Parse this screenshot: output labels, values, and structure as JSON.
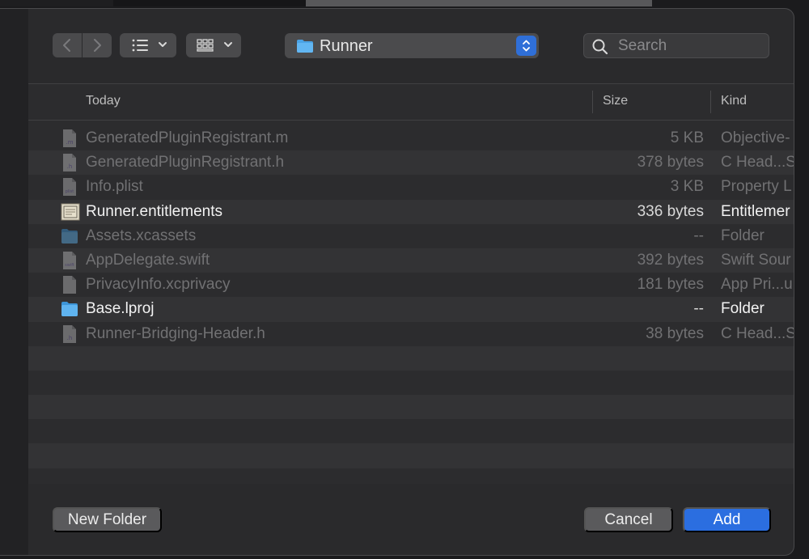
{
  "colors": {
    "accent": "#2b6ee0",
    "folder": "#4aa3e6",
    "panel": "#2a2a2c"
  },
  "toolbar": {
    "back_icon": "chevron-left-icon",
    "forward_icon": "chevron-right-icon",
    "list_view_icon": "list-view-icon",
    "grid_view_icon": "grid-view-icon"
  },
  "location": {
    "label": "Runner",
    "icon": "folder-icon"
  },
  "search": {
    "placeholder": "Search",
    "value": ""
  },
  "columns": {
    "name": "Today",
    "size": "Size",
    "kind": "Kind"
  },
  "files": [
    {
      "name": "GeneratedPluginRegistrant.m",
      "size": "5 KB",
      "kind": "Objective-",
      "icon": "objc-source-file-icon",
      "enabled": false
    },
    {
      "name": "GeneratedPluginRegistrant.h",
      "size": "378 bytes",
      "kind": "C Head...S",
      "icon": "header-file-icon",
      "enabled": false
    },
    {
      "name": "Info.plist",
      "size": "3 KB",
      "kind": "Property L",
      "icon": "plist-file-icon",
      "enabled": false
    },
    {
      "name": "Runner.entitlements",
      "size": "336 bytes",
      "kind": "Entitlemer",
      "icon": "entitlements-file-icon",
      "enabled": true
    },
    {
      "name": "Assets.xcassets",
      "size": "--",
      "kind": "Folder",
      "icon": "folder-icon",
      "enabled": false
    },
    {
      "name": "AppDelegate.swift",
      "size": "392 bytes",
      "kind": "Swift Sour",
      "icon": "swift-file-icon",
      "enabled": false
    },
    {
      "name": "PrivacyInfo.xcprivacy",
      "size": "181 bytes",
      "kind": "App Pri...u",
      "icon": "generic-file-icon",
      "enabled": false
    },
    {
      "name": "Base.lproj",
      "size": "--",
      "kind": "Folder",
      "icon": "folder-icon",
      "enabled": true
    },
    {
      "name": "Runner-Bridging-Header.h",
      "size": "38 bytes",
      "kind": "C Head...S",
      "icon": "header-file-icon",
      "enabled": false
    }
  ],
  "buttons": {
    "new_folder": "New Folder",
    "cancel": "Cancel",
    "add": "Add"
  }
}
